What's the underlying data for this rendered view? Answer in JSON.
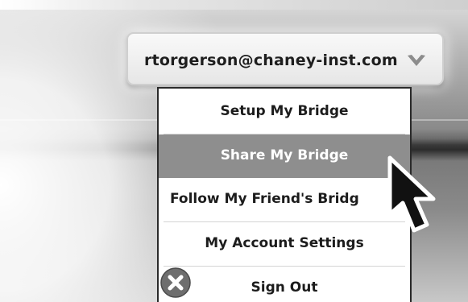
{
  "account_menu": {
    "email": "rtorgerson@chaney-inst.com",
    "expand_icon": "chevron-down-icon"
  },
  "menu": {
    "items": [
      {
        "label": "Setup My Bridge",
        "state": "normal"
      },
      {
        "label": "Share My Bridge",
        "state": "hover"
      },
      {
        "label": "Follow My Friend's Bridg",
        "state": "normal"
      },
      {
        "label": "My Account Settings",
        "state": "normal"
      },
      {
        "label": "Sign Out",
        "state": "normal",
        "icon": "close-circle-icon"
      }
    ]
  },
  "pointer": {
    "icon": "mouse-cursor-icon"
  },
  "colors": {
    "menu_hover": "#8e8e8e",
    "menu_text": "#1c1c1c",
    "menu_border": "#2a2a2a",
    "button_face": "#efefef"
  }
}
